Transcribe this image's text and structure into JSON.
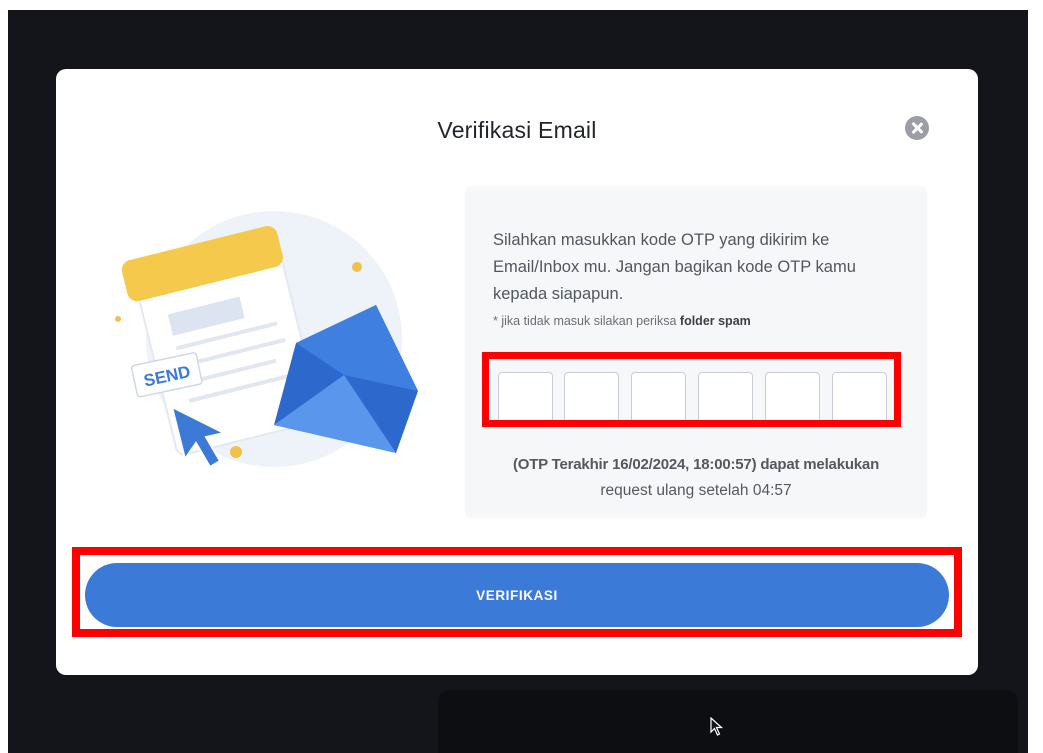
{
  "modal": {
    "title": "Verifikasi Email",
    "close_icon": "close-circle-icon"
  },
  "illustration": {
    "label": "SEND",
    "icons": [
      "document-icon",
      "envelope-icon",
      "cursor-arrow-icon"
    ]
  },
  "instructions": {
    "text": "Silahkan masukkan kode OTP yang dikirim ke Email/Inbox mu. Jangan bagikan kode OTP kamu kepada siapapun.",
    "note_prefix": "* jika tidak masuk silakan periksa",
    "note_emphasis": "folder spam"
  },
  "otp": {
    "digits": [
      "",
      "",
      "",
      "",
      "",
      ""
    ]
  },
  "resend": {
    "line1": "(OTP Terakhir 16/02/2024, 18:00:57) dapat melakukan",
    "line2": "request ulang setelah 04:57"
  },
  "actions": {
    "verify_label": "VERIFIKASI"
  },
  "colors": {
    "primary": "#3c7ad8",
    "highlight": "#ff0000",
    "backdrop": "#14151a"
  }
}
